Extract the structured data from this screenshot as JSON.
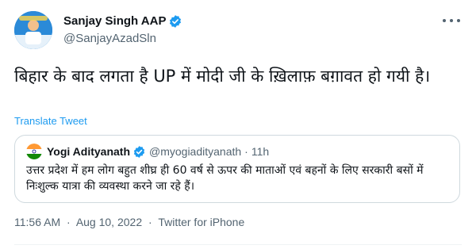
{
  "author": {
    "name": "Sanjay Singh AAP",
    "handle": "@SanjayAzadSln"
  },
  "tweet": {
    "text": "बिहार के बाद लगता है UP में मोदी जी के ख़िलाफ़ बग़ावत हो गयी है।",
    "translate_label": "Translate Tweet"
  },
  "quoted": {
    "name": "Yogi Adityanath",
    "handle": "@myogiadityanath",
    "separator": "·",
    "time": "11h",
    "text": "उत्तर प्रदेश में हम लोग बहुत शीघ्र ही 60 वर्ष से ऊपर की माताओं एवं बहनों के लिए सरकारी बसों में निःशुल्क यात्रा की व्यवस्था करने जा रहे हैं।"
  },
  "footer": {
    "time": "11:56 AM",
    "separator": "·",
    "date": "Aug 10, 2022",
    "source": "Twitter for iPhone"
  },
  "colors": {
    "link": "#1d9bf0",
    "muted": "#536471",
    "verified": "#1d9bf0"
  },
  "icons": [
    "verified-badge-icon",
    "more-options-icon",
    "india-flag-icon"
  ]
}
